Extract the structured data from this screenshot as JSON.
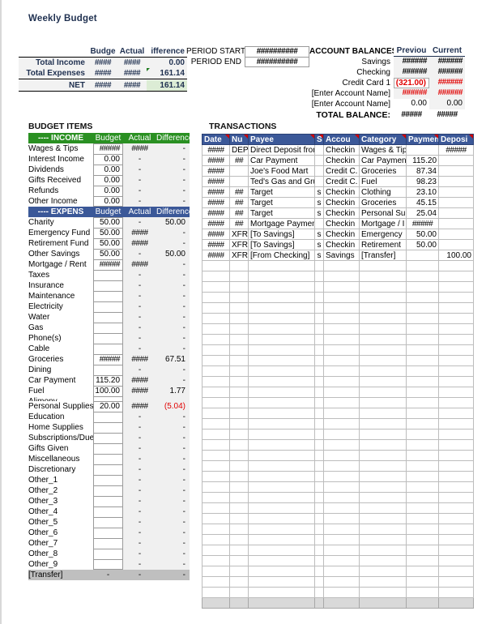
{
  "title": "Weekly Budget",
  "summary": {
    "headers": [
      "Budge",
      "Actual",
      "ifference"
    ],
    "rows": [
      {
        "label": "Total Income",
        "budget": "####",
        "actual": "####",
        "difference": "0.00",
        "flag": false
      },
      {
        "label": "Total Expenses",
        "budget": "####",
        "actual": "####",
        "difference": "161.14",
        "flag": true
      }
    ],
    "net": {
      "label": "NET",
      "budget": "####",
      "actual": "####",
      "difference": "161.14"
    }
  },
  "period": {
    "start_label": "PERIOD START",
    "start_value": "##########",
    "end_label": "PERIOD END",
    "end_value": "##########"
  },
  "balances": {
    "caption": "ACCOUNT BALANCES",
    "col_previous": "Previou",
    "col_current": "Current",
    "rows": [
      {
        "name": "Savings",
        "previous": "######",
        "current": "######"
      },
      {
        "name": "Checking",
        "previous": "######",
        "current": "######"
      },
      {
        "name": "Credit Card 1",
        "previous": "(321.00)",
        "current": "######"
      },
      {
        "name": "[Enter Account Name]",
        "previous": "######",
        "current": "######"
      },
      {
        "name": "[Enter Account Name]",
        "previous": "0.00",
        "current": "0.00"
      }
    ],
    "total_label": "TOTAL BALANCE:",
    "total_previous": "#####",
    "total_current": "#####"
  },
  "budget_items": {
    "caption": "BUDGET ITEMS",
    "income_header": {
      "name": "---- INCOME",
      "budget": "Budget",
      "actual": "Actual",
      "difference": "Difference"
    },
    "expense_header": {
      "name": "---- EXPENS",
      "budget": "Budget",
      "actual": "Actual",
      "difference": "Difference"
    },
    "income": [
      {
        "name": "Wages & Tips",
        "budget": "#####",
        "actual": "####",
        "difference": "-"
      },
      {
        "name": "Interest Income",
        "budget": "0.00",
        "actual": "-",
        "difference": "-"
      },
      {
        "name": "Dividends",
        "budget": "0.00",
        "actual": "-",
        "difference": "-"
      },
      {
        "name": "Gifts Received",
        "budget": "0.00",
        "actual": "-",
        "difference": "-"
      },
      {
        "name": "Refunds",
        "budget": "0.00",
        "actual": "-",
        "difference": "-"
      },
      {
        "name": "Other Income",
        "budget": "0.00",
        "actual": "-",
        "difference": "-"
      }
    ],
    "expenses": [
      {
        "name": "Charity",
        "budget": "50.00",
        "actual": "-",
        "difference": "50.00",
        "short": false,
        "negative": false
      },
      {
        "name": "Emergency Fund",
        "budget": "50.00",
        "actual": "####",
        "difference": "-",
        "short": false,
        "negative": false
      },
      {
        "name": "Retirement Fund",
        "budget": "50.00",
        "actual": "####",
        "difference": "-",
        "short": false,
        "negative": false
      },
      {
        "name": "Other Savings",
        "budget": "50.00",
        "actual": "-",
        "difference": "50.00",
        "short": false,
        "negative": false
      },
      {
        "name": "Mortgage / Rent",
        "budget": "#####",
        "actual": "####",
        "difference": "-",
        "short": false,
        "negative": false
      },
      {
        "name": "Taxes",
        "budget": "",
        "actual": "-",
        "difference": "-",
        "short": false,
        "negative": false
      },
      {
        "name": "Insurance",
        "budget": "",
        "actual": "-",
        "difference": "-",
        "short": false,
        "negative": false
      },
      {
        "name": "Maintenance",
        "budget": "",
        "actual": "-",
        "difference": "-",
        "short": false,
        "negative": false
      },
      {
        "name": "Electricity",
        "budget": "",
        "actual": "-",
        "difference": "-",
        "short": false,
        "negative": false
      },
      {
        "name": "Water",
        "budget": "",
        "actual": "-",
        "difference": "-",
        "short": false,
        "negative": false
      },
      {
        "name": "Gas",
        "budget": "",
        "actual": "-",
        "difference": "-",
        "short": false,
        "negative": false
      },
      {
        "name": "Phone(s)",
        "budget": "",
        "actual": "-",
        "difference": "-",
        "short": false,
        "negative": false
      },
      {
        "name": "Cable",
        "budget": "",
        "actual": "-",
        "difference": "-",
        "short": false,
        "negative": false
      },
      {
        "name": "Groceries",
        "budget": "#####",
        "actual": "####",
        "difference": "67.51",
        "short": false,
        "negative": false
      },
      {
        "name": "Dining",
        "budget": "",
        "actual": "-",
        "difference": "-",
        "short": false,
        "negative": false
      },
      {
        "name": "Car Payment",
        "budget": "115.20",
        "actual": "####",
        "difference": "-",
        "short": false,
        "negative": false
      },
      {
        "name": "Fuel",
        "budget": "100.00",
        "actual": "####",
        "difference": "1.77",
        "short": false,
        "negative": false
      },
      {
        "name": "Alimony",
        "budget": "",
        "actual": "",
        "difference": "",
        "short": true,
        "negative": false
      },
      {
        "name": "Personal Supplies",
        "budget": "20.00",
        "actual": "####",
        "difference": "(5.04)",
        "short": false,
        "negative": true
      },
      {
        "name": "Education",
        "budget": "",
        "actual": "-",
        "difference": "-",
        "short": false,
        "negative": false
      },
      {
        "name": "Home Supplies",
        "budget": "",
        "actual": "-",
        "difference": "-",
        "short": false,
        "negative": false
      },
      {
        "name": "Subscriptions/Dues",
        "budget": "",
        "actual": "-",
        "difference": "-",
        "short": false,
        "negative": false
      },
      {
        "name": "Gifts Given",
        "budget": "",
        "actual": "-",
        "difference": "-",
        "short": false,
        "negative": false
      },
      {
        "name": "Miscellaneous",
        "budget": "",
        "actual": "-",
        "difference": "-",
        "short": false,
        "negative": false
      },
      {
        "name": "Discretionary",
        "budget": "",
        "actual": "-",
        "difference": "-",
        "short": false,
        "negative": false
      },
      {
        "name": "Other_1",
        "budget": "",
        "actual": "-",
        "difference": "-",
        "short": false,
        "negative": false
      },
      {
        "name": "Other_2",
        "budget": "",
        "actual": "-",
        "difference": "-",
        "short": false,
        "negative": false
      },
      {
        "name": "Other_3",
        "budget": "",
        "actual": "-",
        "difference": "-",
        "short": false,
        "negative": false
      },
      {
        "name": "Other_4",
        "budget": "",
        "actual": "-",
        "difference": "-",
        "short": false,
        "negative": false
      },
      {
        "name": "Other_5",
        "budget": "",
        "actual": "-",
        "difference": "-",
        "short": false,
        "negative": false
      },
      {
        "name": "Other_6",
        "budget": "",
        "actual": "-",
        "difference": "-",
        "short": false,
        "negative": false
      },
      {
        "name": "Other_7",
        "budget": "",
        "actual": "-",
        "difference": "-",
        "short": false,
        "negative": false
      },
      {
        "name": "Other_8",
        "budget": "",
        "actual": "-",
        "difference": "-",
        "short": false,
        "negative": false
      },
      {
        "name": "Other_9",
        "budget": "",
        "actual": "-",
        "difference": "-",
        "short": false,
        "negative": false
      }
    ],
    "transfer_row": {
      "name": "[Transfer]",
      "budget": "-",
      "actual": "-",
      "difference": "-"
    }
  },
  "transactions": {
    "caption": "TRANSACTIONS",
    "columns": [
      "Date",
      "Nu",
      "Payee",
      "S",
      "Accou",
      "Category",
      "Paymen",
      "Deposi"
    ],
    "rows": [
      {
        "date": "####",
        "num": "DEP",
        "payee": "Direct Deposit from",
        "split": "",
        "account": "Checkin",
        "category": "Wages & Tips",
        "payment": "",
        "deposit": "#####"
      },
      {
        "date": "####",
        "num": "##",
        "payee": "Car Payment",
        "split": "",
        "account": "Checkin",
        "category": "Car Paymen",
        "payment": "115.20",
        "deposit": ""
      },
      {
        "date": "####",
        "num": "",
        "payee": "Joe's Food Mart",
        "split": "",
        "account": "Credit C.",
        "category": "Groceries",
        "payment": "87.34",
        "deposit": ""
      },
      {
        "date": "####",
        "num": "",
        "payee": "Ted's Gas and Gru",
        "split": "",
        "account": "Credit C.",
        "category": "Fuel",
        "payment": "98.23",
        "deposit": ""
      },
      {
        "date": "####",
        "num": "##",
        "payee": "Target",
        "split": "s",
        "account": "Checkin",
        "category": "Clothing",
        "payment": "23.10",
        "deposit": ""
      },
      {
        "date": "####",
        "num": "##",
        "payee": "Target",
        "split": "s",
        "account": "Checkin",
        "category": "Groceries",
        "payment": "45.15",
        "deposit": ""
      },
      {
        "date": "####",
        "num": "##",
        "payee": "Target",
        "split": "s",
        "account": "Checkin",
        "category": "Personal Su",
        "payment": "25.04",
        "deposit": ""
      },
      {
        "date": "####",
        "num": "##",
        "payee": "Mortgage Paymen",
        "split": "",
        "account": "Checkin",
        "category": "Mortgage / I",
        "payment": "#####",
        "deposit": ""
      },
      {
        "date": "####",
        "num": "XFR",
        "payee": "[To Savings]",
        "split": "s",
        "account": "Checkin",
        "category": "Emergency",
        "payment": "50.00",
        "deposit": ""
      },
      {
        "date": "####",
        "num": "XFR",
        "payee": "[To Savings]",
        "split": "s",
        "account": "Checkin",
        "category": "Retirement",
        "payment": "50.00",
        "deposit": ""
      },
      {
        "date": "####",
        "num": "XFR",
        "payee": "[From Checking]",
        "split": "s",
        "account": "Savings",
        "category": "[Transfer]",
        "payment": "",
        "deposit": "100.00"
      }
    ],
    "blank_row_count": 32,
    "total_row": {
      "date": "",
      "num": "",
      "payee": "",
      "split": "",
      "account": "",
      "category": "",
      "payment": "",
      "deposit": ""
    }
  },
  "colors": {
    "income_header_bg": "#2a9022",
    "expense_header_bg": "#3b5898",
    "negative_text": "#e00000",
    "net_highlight_bg": "#dcecd5",
    "transfer_row_bg": "#bfbfbf",
    "total_row_bg": "#d9d9d9"
  }
}
